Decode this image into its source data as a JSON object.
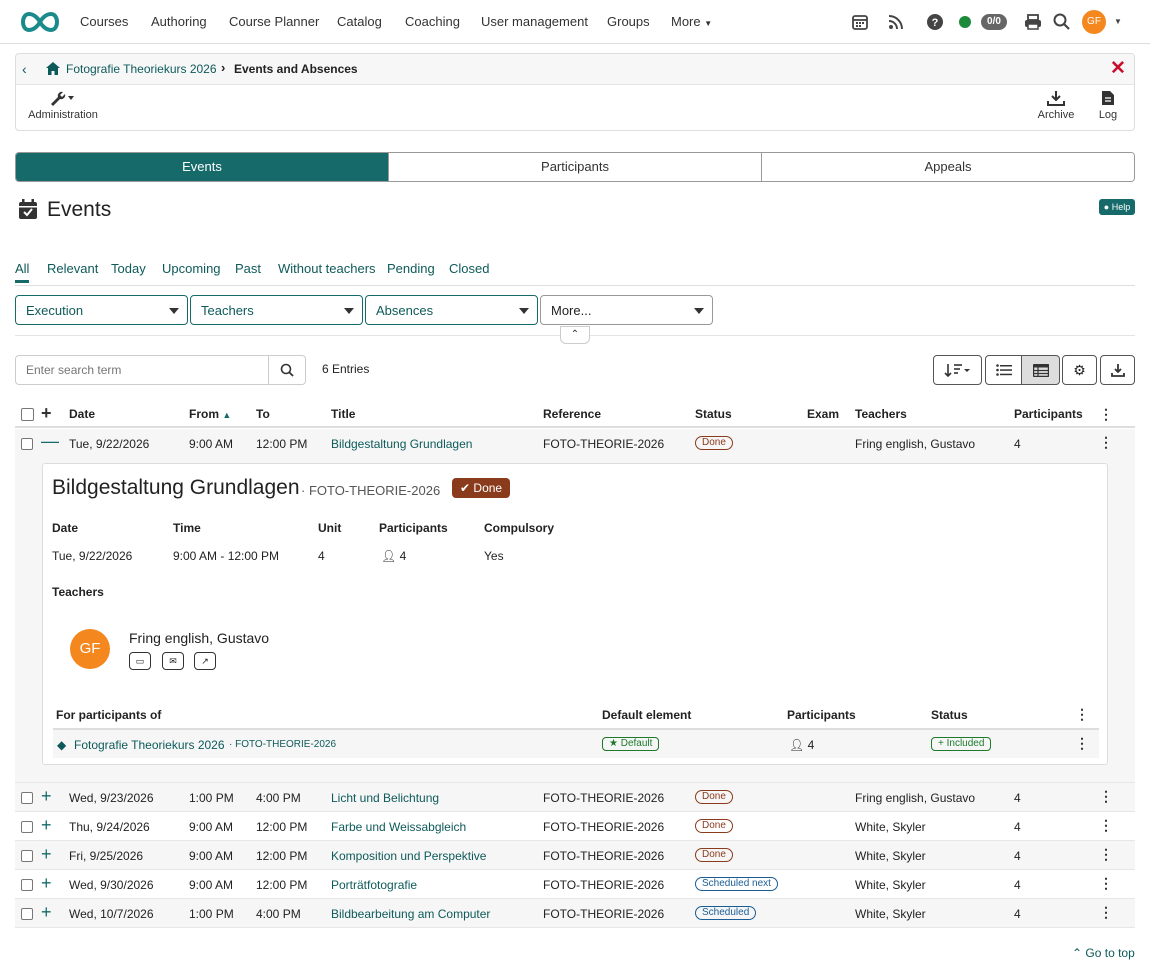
{
  "nav": {
    "items": [
      "Courses",
      "Authoring",
      "Course Planner",
      "Catalog",
      "Coaching",
      "User management",
      "Groups",
      "More"
    ],
    "counter": "0/0",
    "avatar_initials": "GF",
    "status_color": "#1c8a3a"
  },
  "breadcrumb": {
    "course": "Fotografie Theoriekurs 2026",
    "current": "Events and Absences"
  },
  "toolbar": {
    "administration": "Administration",
    "archive": "Archive",
    "log": "Log"
  },
  "segments": [
    "Events",
    "Participants",
    "Appeals"
  ],
  "page": {
    "title": "Events",
    "help": "Help"
  },
  "filter_tabs": [
    "All",
    "Relevant",
    "Today",
    "Upcoming",
    "Past",
    "Without teachers",
    "Pending",
    "Closed"
  ],
  "filters": [
    "Execution",
    "Teachers",
    "Absences",
    "More..."
  ],
  "search": {
    "placeholder": "Enter search term",
    "entries": "6 Entries"
  },
  "table": {
    "headers": [
      "Date",
      "From",
      "To",
      "Title",
      "Reference",
      "Status",
      "Exam",
      "Teachers",
      "Participants"
    ],
    "rows": [
      {
        "date": "Tue, 9/22/2026",
        "from": "9:00 AM",
        "to": "12:00 PM",
        "title": "Bildgestaltung Grundlagen",
        "reference": "FOTO-THEORIE-2026",
        "status": "Done",
        "teachers": "Fring english, Gustavo",
        "participants": "4"
      },
      {
        "date": "Wed, 9/23/2026",
        "from": "1:00 PM",
        "to": "4:00 PM",
        "title": "Licht und Belichtung",
        "reference": "FOTO-THEORIE-2026",
        "status": "Done",
        "teachers": "Fring english, Gustavo",
        "participants": "4"
      },
      {
        "date": "Thu, 9/24/2026",
        "from": "9:00 AM",
        "to": "12:00 PM",
        "title": "Farbe und Weissabgleich",
        "reference": "FOTO-THEORIE-2026",
        "status": "Done",
        "teachers": "White, Skyler",
        "participants": "4"
      },
      {
        "date": "Fri, 9/25/2026",
        "from": "9:00 AM",
        "to": "12:00 PM",
        "title": "Komposition und Perspektive",
        "reference": "FOTO-THEORIE-2026",
        "status": "Done",
        "teachers": "White, Skyler",
        "participants": "4"
      },
      {
        "date": "Wed, 9/30/2026",
        "from": "9:00 AM",
        "to": "12:00 PM",
        "title": "Porträtfotografie",
        "reference": "FOTO-THEORIE-2026",
        "status": "Scheduled next",
        "teachers": "White, Skyler",
        "participants": "4"
      },
      {
        "date": "Wed, 10/7/2026",
        "from": "1:00 PM",
        "to": "4:00 PM",
        "title": "Bildbearbeitung am Computer",
        "reference": "FOTO-THEORIE-2026",
        "status": "Scheduled",
        "teachers": "White, Skyler",
        "participants": "4"
      }
    ]
  },
  "detail": {
    "title": "Bildgestaltung Grundlagen",
    "reference": "· FOTO-THEORIE-2026",
    "status": "Done",
    "labels": {
      "date": "Date",
      "time": "Time",
      "unit": "Unit",
      "participants": "Participants",
      "compulsory": "Compulsory",
      "teachers": "Teachers"
    },
    "values": {
      "date": "Tue, 9/22/2026",
      "time": "9:00 AM - 12:00 PM",
      "unit": "4",
      "participants": "4",
      "compulsory": "Yes"
    },
    "teacher": {
      "initials": "GF",
      "name": "Fring english, Gustavo"
    },
    "sub_headers": [
      "For participants of",
      "Default element",
      "Participants",
      "Status"
    ],
    "sub_row": {
      "course": "Fotografie Theoriekurs 2026",
      "ref": "· FOTO-THEORIE-2026",
      "default": "Default",
      "participants": "4",
      "status": "Included"
    }
  },
  "footer": {
    "go_to_top": "Go to top"
  }
}
